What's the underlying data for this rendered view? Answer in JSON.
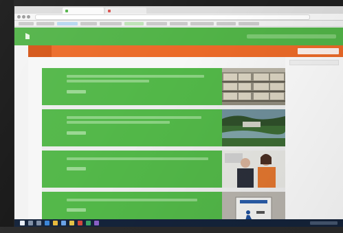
{
  "site": {
    "logo_text": "",
    "nav": [
      "",
      "",
      "",
      "",
      "",
      "",
      ""
    ]
  },
  "articles": [
    {
      "day": "",
      "month": "",
      "title": ""
    },
    {
      "day": "",
      "month": "",
      "title": ""
    },
    {
      "day": "",
      "month": "",
      "title": ""
    },
    {
      "day": "",
      "month": "",
      "title": ""
    }
  ],
  "colors": {
    "brand_green": "#51b347",
    "nav_orange": "#eb6a28",
    "article_green": "#52b748",
    "taskbar": "#14233a"
  },
  "icons": [
    "logo-icon",
    "search-box",
    "windows-start-icon",
    "browser-icon"
  ]
}
